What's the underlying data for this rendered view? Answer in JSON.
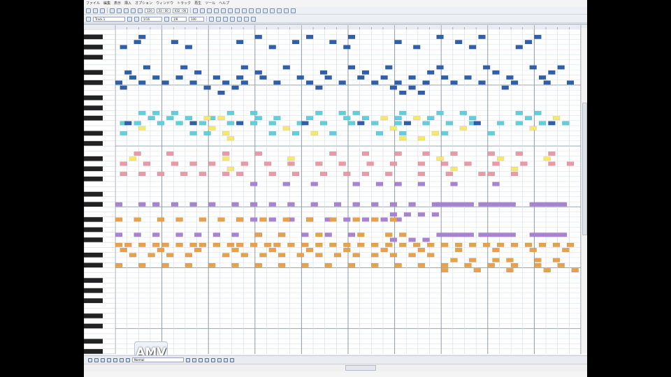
{
  "app": {
    "logo_text": "AMV"
  },
  "menubar": {
    "items": [
      "ファイル",
      "編集",
      "表示",
      "挿入",
      "オプション",
      "ウィンドウ",
      "トラック",
      "再生",
      "ツール",
      "ヘルプ"
    ]
  },
  "toolbar": {
    "tempo": "120",
    "position": "33 : 00",
    "time": "032 : 00",
    "track_field": "Track 1",
    "quantize": "1/16",
    "note_length": "1/8",
    "gate": "100"
  },
  "statusbar": {
    "field_value": "Normal"
  },
  "colors": {
    "window_bg": "#f4f4f4",
    "grid_bg": "#ffffff",
    "dark_blue": "#2e5fa8",
    "cyan": "#5fcfdc",
    "yellow": "#f5e86a",
    "pink": "#e89aa6",
    "purple": "#a783d1",
    "orange": "#e5a24a"
  },
  "piano_roll": {
    "bars": 10,
    "pitches_visible": 64,
    "notes": [
      {
        "c": "dark_blue",
        "p": 1,
        "b": [
          0.5,
          3.0,
          4.1,
          5.0,
          6.9,
          7.8,
          9.0
        ]
      },
      {
        "c": "dark_blue",
        "p": 2,
        "b": [
          0.4,
          1.2,
          2.6,
          3.8,
          4.6,
          6.0,
          7.3,
          8.8
        ]
      },
      {
        "c": "dark_blue",
        "p": 3,
        "b": [
          0.1,
          1.5,
          3.3,
          4.9,
          6.4,
          7.6,
          8.6
        ]
      },
      {
        "c": "dark_blue",
        "p": 7,
        "b": [
          0.6,
          1.4,
          2.7,
          3.6,
          5.0,
          5.8,
          6.9,
          7.9,
          8.9,
          9.5
        ]
      },
      {
        "c": "dark_blue",
        "p": 8,
        "b": [
          0.2,
          1.7,
          3.0,
          4.4,
          5.3,
          6.7,
          8.1,
          9.3
        ]
      },
      {
        "c": "dark_blue",
        "p": 9,
        "b": [
          0.3,
          0.8,
          1.3,
          2.1,
          2.6,
          3.1,
          3.9,
          4.5,
          5.2,
          5.7,
          6.3,
          7.0,
          7.5,
          8.4,
          9.1
        ]
      },
      {
        "c": "dark_blue",
        "p": 10,
        "b": [
          0.0,
          0.5,
          1.0,
          1.6,
          2.3,
          2.7,
          3.4,
          4.1,
          4.8,
          5.5,
          6.0,
          6.6,
          7.2,
          7.8,
          8.5,
          9.2,
          9.7
        ]
      },
      {
        "c": "dark_blue",
        "p": 11,
        "b": [
          0.1,
          1.9,
          2.5,
          4.3,
          5.9,
          6.3,
          8.3
        ]
      },
      {
        "c": "dark_blue",
        "p": 12,
        "b": [
          2.2,
          6.1,
          6.5
        ]
      },
      {
        "c": "cyan",
        "p": 16,
        "b": [
          0.5,
          0.8,
          1.2,
          2.4,
          2.9,
          4.3,
          4.8,
          5.1,
          6.1,
          6.9,
          7.4,
          8.6,
          9.0
        ]
      },
      {
        "c": "cyan",
        "p": 17,
        "b": [
          0.7,
          1.1,
          1.5,
          2.0,
          3.0,
          3.4,
          4.1,
          4.9,
          5.3,
          6.0,
          6.7,
          7.6,
          8.8
        ]
      },
      {
        "c": "yellow",
        "p": 17,
        "b": [
          1.9,
          2.2,
          5.7,
          6.4,
          9.4
        ]
      },
      {
        "c": "cyan",
        "p": 18,
        "b": [
          0.1,
          0.4,
          0.9,
          1.3,
          1.8,
          2.4,
          2.9,
          3.3,
          3.9,
          4.4,
          5.0,
          5.5,
          6.0,
          6.6,
          7.1,
          7.6,
          8.2,
          8.6,
          9.1,
          9.6
        ]
      },
      {
        "c": "dark_blue",
        "p": 18,
        "b": [
          0.2,
          1.6,
          2.6,
          4.0,
          5.2,
          6.2,
          7.7,
          9.3
        ]
      },
      {
        "c": "yellow",
        "p": 19,
        "b": [
          0.5,
          2.0,
          3.6,
          5.9,
          7.4,
          8.9
        ]
      },
      {
        "c": "cyan",
        "p": 20,
        "b": [
          0.1,
          1.6,
          1.9,
          3.3,
          3.8,
          4.6,
          5.6,
          6.1,
          7.0,
          8.0
        ]
      },
      {
        "c": "yellow",
        "p": 20,
        "b": [
          2.3,
          4.2,
          6.8
        ]
      },
      {
        "c": "yellow",
        "p": 21,
        "b": [
          2.4,
          6.1,
          6.5
        ]
      },
      {
        "c": "pink",
        "p": 24,
        "b": [
          0.4,
          1.1,
          2.3,
          3.0,
          4.6,
          5.3,
          6.0,
          6.6,
          7.2,
          8.0,
          8.6,
          9.3
        ]
      },
      {
        "c": "yellow",
        "p": 25,
        "b": [
          0.3,
          2.3,
          3.7,
          6.9,
          8.2,
          9.2
        ]
      },
      {
        "c": "pink",
        "p": 26,
        "b": [
          0.1,
          0.6,
          1.2,
          1.6,
          2.0,
          2.7,
          3.2,
          3.7,
          4.3,
          4.8,
          5.4,
          5.9,
          6.5,
          7.0,
          7.5,
          8.1,
          8.7,
          9.3,
          9.7
        ]
      },
      {
        "c": "yellow",
        "p": 27,
        "b": [
          2.4,
          7.2,
          8.5
        ]
      },
      {
        "c": "pink",
        "p": 28,
        "b": [
          0.1,
          0.5,
          0.9,
          1.4,
          1.8,
          2.3,
          2.6,
          3.3,
          3.8,
          4.4,
          4.9,
          5.3,
          5.8,
          6.5,
          7.1,
          7.8,
          8.0,
          8.5
        ]
      },
      {
        "c": "purple",
        "p": 30,
        "b": [
          2.9,
          3.6,
          4.2,
          5.1,
          5.6,
          6.0,
          6.5,
          7.2,
          8.1
        ]
      },
      {
        "c": "purple",
        "p": 34,
        "b": [
          0.0,
          0.5,
          0.8,
          1.2,
          1.6,
          2.0,
          2.5,
          2.9,
          3.3,
          3.7,
          4.2,
          4.7,
          5.1,
          5.5,
          5.9,
          6.3,
          6.8
        ]
      },
      {
        "c": "purple",
        "p": 34,
        "l": 0.8,
        "b": [
          6.9,
          7.8,
          8.9
        ]
      },
      {
        "c": "purple",
        "p": 36,
        "b": [
          5.9,
          6.2,
          6.5,
          6.8
        ]
      },
      {
        "c": "purple",
        "p": 37,
        "b": [
          2.6,
          2.9,
          3.3,
          3.7,
          4.1,
          4.5,
          4.9,
          5.3,
          5.7,
          6.0
        ]
      },
      {
        "c": "orange",
        "p": 37,
        "b": [
          0.0,
          0.4,
          0.9,
          1.3,
          1.8,
          2.2,
          2.6,
          3.1,
          3.6,
          4.1,
          4.6,
          5.1,
          5.5,
          5.9
        ]
      },
      {
        "c": "purple",
        "p": 40,
        "b": [
          0.0,
          0.4,
          0.8,
          1.3,
          1.7,
          2.1,
          2.5,
          3.0,
          3.5,
          4.0,
          4.5,
          5.0
        ]
      },
      {
        "c": "purple",
        "p": 40,
        "l": 0.8,
        "b": [
          6.9,
          7.8,
          8.9
        ]
      },
      {
        "c": "orange",
        "p": 40,
        "b": [
          3.0,
          3.5,
          4.3,
          5.2,
          5.8,
          6.1
        ]
      },
      {
        "c": "purple",
        "p": 41,
        "b": [
          5.9,
          6.3,
          6.6
        ]
      },
      {
        "c": "orange",
        "p": 42,
        "b": [
          0.0,
          0.2,
          0.5,
          0.8,
          1.0,
          1.3,
          1.6,
          1.8,
          2.1,
          2.4,
          2.6,
          2.9,
          3.2,
          3.4,
          3.7,
          4.0,
          4.3,
          4.6,
          4.9,
          5.2,
          5.5,
          5.8,
          6.1,
          6.4,
          6.7,
          7.0,
          7.3,
          7.6,
          7.9,
          8.2,
          8.5,
          8.8,
          9.1,
          9.4,
          9.7
        ]
      },
      {
        "c": "orange",
        "p": 43,
        "b": [
          0.1,
          0.9,
          1.7,
          2.5,
          3.3,
          4.1,
          4.9,
          5.7,
          6.5,
          7.3,
          8.1,
          8.9,
          9.6
        ]
      },
      {
        "c": "orange",
        "p": 44,
        "b": [
          0.3,
          0.7,
          1.1,
          1.5,
          2.3,
          2.7,
          3.1,
          3.5,
          3.9,
          4.3,
          4.7,
          5.1,
          5.5,
          5.9,
          6.3,
          6.7
        ]
      },
      {
        "c": "orange",
        "p": 45,
        "b": [
          7.2,
          7.6,
          8.1,
          8.4,
          9.0,
          9.4
        ]
      },
      {
        "c": "orange",
        "p": 46,
        "b": [
          0.0,
          0.5,
          1.0,
          1.5,
          2.0,
          2.5,
          3.0,
          3.5,
          4.0,
          4.5,
          5.0,
          5.5,
          6.0,
          6.5,
          7.0,
          7.5,
          8.0,
          8.5,
          9.0,
          9.5
        ]
      },
      {
        "c": "orange",
        "p": 47,
        "b": [
          7.0,
          7.7,
          8.4,
          9.2,
          9.8
        ]
      }
    ]
  }
}
